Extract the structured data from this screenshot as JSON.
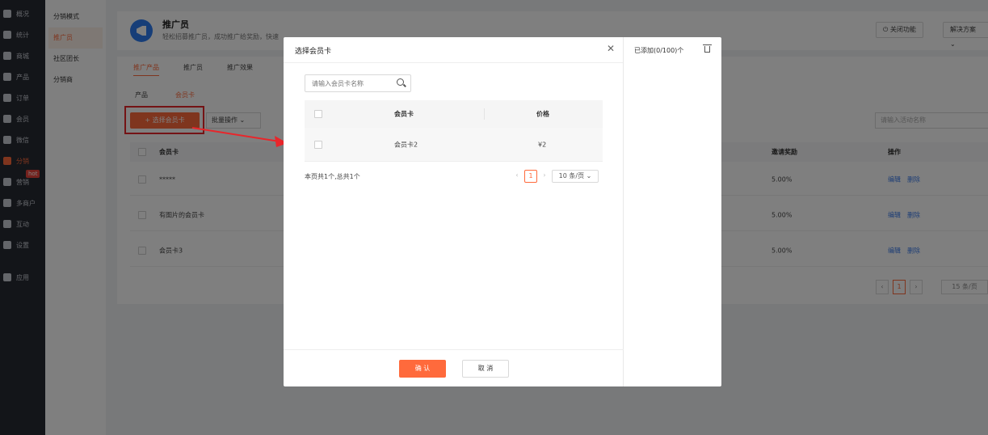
{
  "rail": {
    "items": [
      {
        "label": "概况"
      },
      {
        "label": "统计"
      },
      {
        "label": "商城"
      },
      {
        "label": "产品"
      },
      {
        "label": "订单"
      },
      {
        "label": "会员"
      },
      {
        "label": "微信"
      },
      {
        "label": "分销"
      },
      {
        "label": "营销"
      },
      {
        "label": "多商户"
      },
      {
        "label": "互动"
      },
      {
        "label": "设置"
      },
      {
        "label": "应用"
      }
    ],
    "hot_badge": "hot",
    "accent_color": "#ff6a3c"
  },
  "subnav": {
    "items": [
      {
        "label": "分销模式"
      },
      {
        "label": "推广员"
      },
      {
        "label": "社区团长"
      },
      {
        "label": "分销商"
      }
    ]
  },
  "header": {
    "title": "推广员",
    "subtitle": "轻松招募推广员，成功推广给奖励，快速",
    "close_feature": "关闭功能",
    "solutions": "解决方案"
  },
  "main": {
    "tabs": [
      "推广产品",
      "推广员",
      "推广效果"
    ],
    "subtabs": [
      "产品",
      "会员卡"
    ],
    "add_button": "+ 选择会员卡",
    "batch_button": "批量操作",
    "search_placeholder": "请输入活动名称",
    "table": {
      "headers": {
        "card": "会员卡",
        "reward": "邀请奖励",
        "action": "操作"
      },
      "rows": [
        {
          "name": "*****",
          "reward": "5.00%"
        },
        {
          "name": "有图片的会员卡",
          "reward": "5.00%"
        },
        {
          "name": "会员卡3",
          "reward": "5.00%"
        }
      ],
      "edit": "编辑",
      "delete": "删除"
    },
    "pager": {
      "page": "1",
      "size": "15 条/页"
    }
  },
  "modal": {
    "title": "选择会员卡",
    "search_placeholder": "请输入会员卡名称",
    "headers": {
      "card": "会员卡",
      "price": "价格"
    },
    "rows": [
      {
        "card": "会员卡2",
        "price": "¥2"
      }
    ],
    "summary": "本页共1个,总共1个",
    "page": "1",
    "page_size": "10 条/页",
    "added": "已添加(0/100)个",
    "ok": "确 认",
    "cancel": "取 消"
  }
}
